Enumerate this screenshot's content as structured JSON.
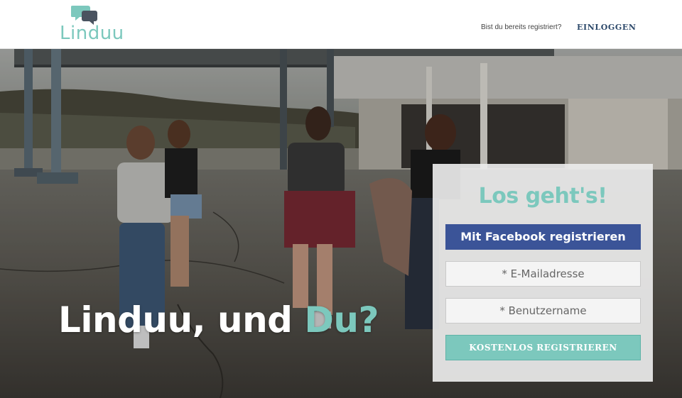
{
  "header": {
    "logo_text": "Linduu",
    "question": "Bist du bereits registriert?",
    "login_label": "EINLOGGEN"
  },
  "hero": {
    "heading_main": "Linduu, und ",
    "heading_accent": "Du?",
    "image_icon": "photo-four-women-walking"
  },
  "signup": {
    "title": "Los geht's!",
    "facebook_label": "Mit Facebook registrieren",
    "email_placeholder": "* E-Mailadresse",
    "username_placeholder": "* Benutzername",
    "register_label": "KOSTENLOS REGISTRIEREN"
  },
  "colors": {
    "accent": "#7cc8bd",
    "facebook": "#3b5498",
    "login_text": "#2e4a6b"
  }
}
